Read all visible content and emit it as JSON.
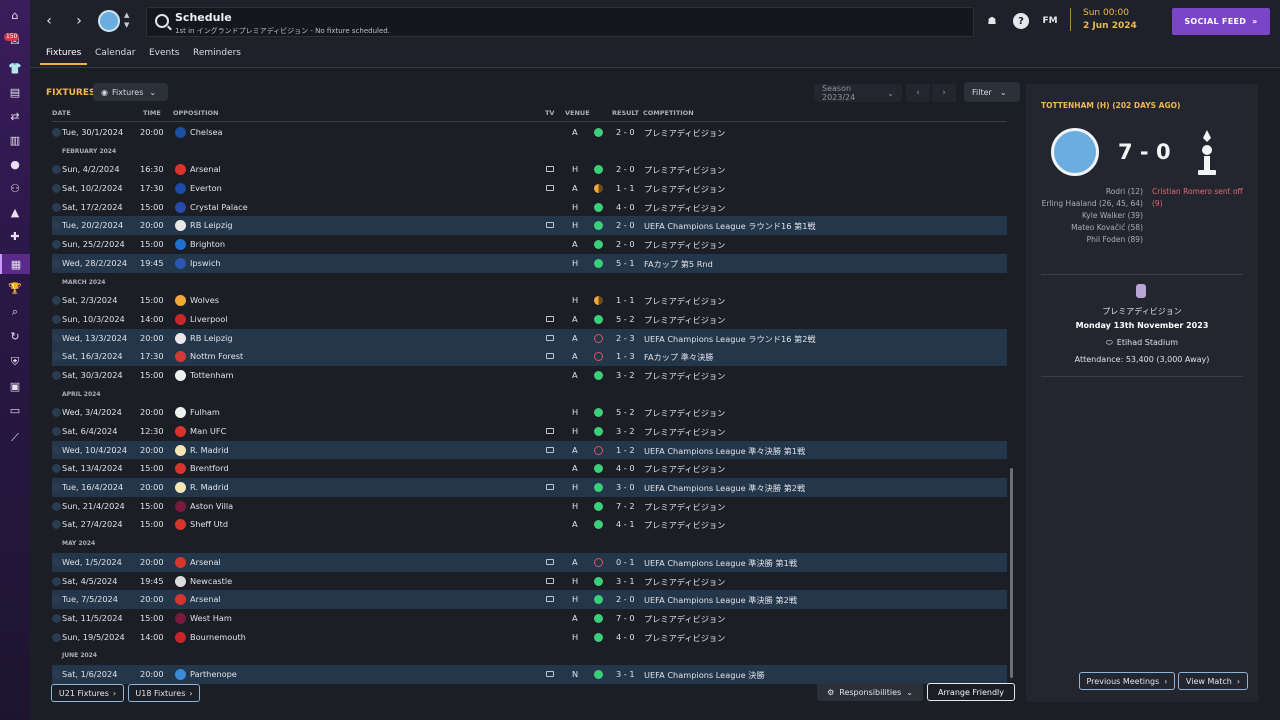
{
  "sidebar": {
    "badge": "150"
  },
  "header": {
    "title": "Schedule",
    "subtitle": "1st in イングランドプレミアディビジョン - No fixture scheduled.",
    "fm_label": "FM",
    "time": "Sun 00:00",
    "date": "2 Jun 2024",
    "social_feed": "SOCIAL FEED"
  },
  "tabs": [
    "Fixtures",
    "Calendar",
    "Events",
    "Reminders"
  ],
  "fixtures": {
    "title": "FIXTURES",
    "view_dropdown": "Fixtures",
    "season": "Season 2023/24",
    "filter": "Filter",
    "columns": {
      "date": "DATE",
      "time": "TIME",
      "opposition": "OPPOSITION",
      "tv": "TV",
      "venue": "VENUE",
      "result": "RESULT",
      "competition": "COMPETITION"
    },
    "rows": [
      {
        "date": "Tue, 30/1/2024",
        "time": "20:00",
        "opp": "Chelsea",
        "tv": false,
        "venue": "A",
        "res": "W",
        "score": "2 - 0",
        "comp": "プレミアディビジョン",
        "hl": false,
        "color": "#1d4fa0"
      },
      {
        "month": "FEBRUARY 2024"
      },
      {
        "date": "Sun, 4/2/2024",
        "time": "16:30",
        "opp": "Arsenal",
        "tv": true,
        "venue": "H",
        "res": "W",
        "score": "2 - 0",
        "comp": "プレミアディビジョン",
        "hl": false,
        "color": "#d8342e"
      },
      {
        "date": "Sat, 10/2/2024",
        "time": "17:30",
        "opp": "Everton",
        "tv": true,
        "venue": "A",
        "res": "D",
        "score": "1 - 1",
        "comp": "プレミアディビジョン",
        "hl": false,
        "color": "#1b4ba6"
      },
      {
        "date": "Sat, 17/2/2024",
        "time": "15:00",
        "opp": "Crystal Palace",
        "tv": false,
        "venue": "H",
        "res": "W",
        "score": "4 - 0",
        "comp": "プレミアディビジョン",
        "hl": false,
        "color": "#2a4aa8"
      },
      {
        "date": "Tue, 20/2/2024",
        "time": "20:00",
        "opp": "RB Leipzig",
        "tv": true,
        "venue": "H",
        "res": "W",
        "score": "2 - 0",
        "comp": "UEFA Champions League ラウンド16 第1戦",
        "hl": true,
        "color": "#e8e8e8"
      },
      {
        "date": "Sun, 25/2/2024",
        "time": "15:00",
        "opp": "Brighton",
        "tv": false,
        "venue": "A",
        "res": "W",
        "score": "2 - 0",
        "comp": "プレミアディビジョン",
        "hl": false,
        "color": "#1f6fd1"
      },
      {
        "date": "Wed, 28/2/2024",
        "time": "19:45",
        "opp": "Ipswich",
        "tv": false,
        "venue": "H",
        "res": "W",
        "score": "5 - 1",
        "comp": "FAカップ 第5 Rnd",
        "hl": true,
        "color": "#2b56b3"
      },
      {
        "month": "MARCH 2024"
      },
      {
        "date": "Sat, 2/3/2024",
        "time": "15:00",
        "opp": "Wolves",
        "tv": false,
        "venue": "H",
        "res": "D",
        "score": "1 - 1",
        "comp": "プレミアディビジョン",
        "hl": false,
        "color": "#f0a93a"
      },
      {
        "date": "Sun, 10/3/2024",
        "time": "14:00",
        "opp": "Liverpool",
        "tv": true,
        "venue": "A",
        "res": "W",
        "score": "5 - 2",
        "comp": "プレミアディビジョン",
        "hl": false,
        "color": "#c9262c"
      },
      {
        "date": "Wed, 13/3/2024",
        "time": "20:00",
        "opp": "RB Leipzig",
        "tv": true,
        "venue": "A",
        "res": "L",
        "score": "2 - 3",
        "comp": "UEFA Champions League ラウンド16 第2戦",
        "hl": true,
        "color": "#e8e8e8"
      },
      {
        "date": "Sat, 16/3/2024",
        "time": "17:30",
        "opp": "Nottm Forest",
        "tv": true,
        "venue": "A",
        "res": "L",
        "score": "1 - 3",
        "comp": "FAカップ 準々決勝",
        "hl": true,
        "color": "#d23a3a"
      },
      {
        "date": "Sat, 30/3/2024",
        "time": "15:00",
        "opp": "Tottenham",
        "tv": false,
        "venue": "A",
        "res": "W",
        "score": "3 - 2",
        "comp": "プレミアディビジョン",
        "hl": false,
        "color": "#f0f0f0"
      },
      {
        "month": "APRIL 2024"
      },
      {
        "date": "Wed, 3/4/2024",
        "time": "20:00",
        "opp": "Fulham",
        "tv": false,
        "venue": "H",
        "res": "W",
        "score": "5 - 2",
        "comp": "プレミアディビジョン",
        "hl": false,
        "color": "#f0f0f0"
      },
      {
        "date": "Sat, 6/4/2024",
        "time": "12:30",
        "opp": "Man UFC",
        "tv": true,
        "venue": "H",
        "res": "W",
        "score": "3 - 2",
        "comp": "プレミアディビジョン",
        "hl": false,
        "color": "#d8342e"
      },
      {
        "date": "Wed, 10/4/2024",
        "time": "20:00",
        "opp": "R. Madrid",
        "tv": true,
        "venue": "A",
        "res": "L",
        "score": "1 - 2",
        "comp": "UEFA Champions League 準々決勝 第1戦",
        "hl": true,
        "color": "#f3e7b8"
      },
      {
        "date": "Sat, 13/4/2024",
        "time": "15:00",
        "opp": "Brentford",
        "tv": false,
        "venue": "A",
        "res": "W",
        "score": "4 - 0",
        "comp": "プレミアディビジョン",
        "hl": false,
        "color": "#d8342e"
      },
      {
        "date": "Tue, 16/4/2024",
        "time": "20:00",
        "opp": "R. Madrid",
        "tv": true,
        "venue": "H",
        "res": "W",
        "score": "3 - 0",
        "comp": "UEFA Champions League 準々決勝 第2戦",
        "hl": true,
        "color": "#f3e7b8"
      },
      {
        "date": "Sun, 21/4/2024",
        "time": "15:00",
        "opp": "Aston Villa",
        "tv": false,
        "venue": "H",
        "res": "W",
        "score": "7 - 2",
        "comp": "プレミアディビジョン",
        "hl": false,
        "color": "#7a1b3e"
      },
      {
        "date": "Sat, 27/4/2024",
        "time": "15:00",
        "opp": "Sheff Utd",
        "tv": false,
        "venue": "A",
        "res": "W",
        "score": "4 - 1",
        "comp": "プレミアディビジョン",
        "hl": false,
        "color": "#d8342e"
      },
      {
        "month": "MAY 2024"
      },
      {
        "date": "Wed, 1/5/2024",
        "time": "20:00",
        "opp": "Arsenal",
        "tv": true,
        "venue": "A",
        "res": "L",
        "score": "0 - 1",
        "comp": "UEFA Champions League 準決勝 第1戦",
        "hl": true,
        "color": "#d8342e"
      },
      {
        "date": "Sat, 4/5/2024",
        "time": "19:45",
        "opp": "Newcastle",
        "tv": true,
        "venue": "H",
        "res": "W",
        "score": "3 - 1",
        "comp": "プレミアディビジョン",
        "hl": false,
        "color": "#dcdcdc"
      },
      {
        "date": "Tue, 7/5/2024",
        "time": "20:00",
        "opp": "Arsenal",
        "tv": true,
        "venue": "H",
        "res": "W",
        "score": "2 - 0",
        "comp": "UEFA Champions League 準決勝 第2戦",
        "hl": true,
        "color": "#d8342e"
      },
      {
        "date": "Sat, 11/5/2024",
        "time": "15:00",
        "opp": "West Ham",
        "tv": false,
        "venue": "A",
        "res": "W",
        "score": "7 - 0",
        "comp": "プレミアディビジョン",
        "hl": false,
        "color": "#7a1b3e"
      },
      {
        "date": "Sun, 19/5/2024",
        "time": "14:00",
        "opp": "Bournemouth",
        "tv": false,
        "venue": "H",
        "res": "W",
        "score": "4 - 0",
        "comp": "プレミアディビジョン",
        "hl": false,
        "color": "#c9262c"
      },
      {
        "month": "JUNE 2024"
      },
      {
        "date": "Sat, 1/6/2024",
        "time": "20:00",
        "opp": "Parthenope",
        "tv": true,
        "venue": "N",
        "res": "W",
        "score": "3 - 1",
        "comp": "UEFA Champions League 決勝",
        "hl": true,
        "color": "#3a8ad8"
      }
    ],
    "u21_button": "U21 Fixtures",
    "u18_button": "U18 Fixtures",
    "responsibilities": "Responsibilities",
    "arrange_friendly": "Arrange Friendly"
  },
  "panel": {
    "title": "TOTTENHAM (H) (202 DAYS AGO)",
    "score": "7 - 0",
    "home_scorers": [
      "Rodri (12)",
      "Erling Haaland (26, 45, 64)",
      "Kyle Walker (39)",
      "Mateo Kovačić (58)",
      "Phil Foden (89)"
    ],
    "away_events": [
      "Cristian Romero sent off (9)"
    ],
    "competition": "プレミアディビジョン",
    "match_date": "Monday 13th November 2023",
    "stadium": "Etihad Stadium",
    "attendance": "Attendance: 53,400 (3,000 Away)",
    "previous_meetings": "Previous Meetings",
    "view_match": "View Match"
  }
}
